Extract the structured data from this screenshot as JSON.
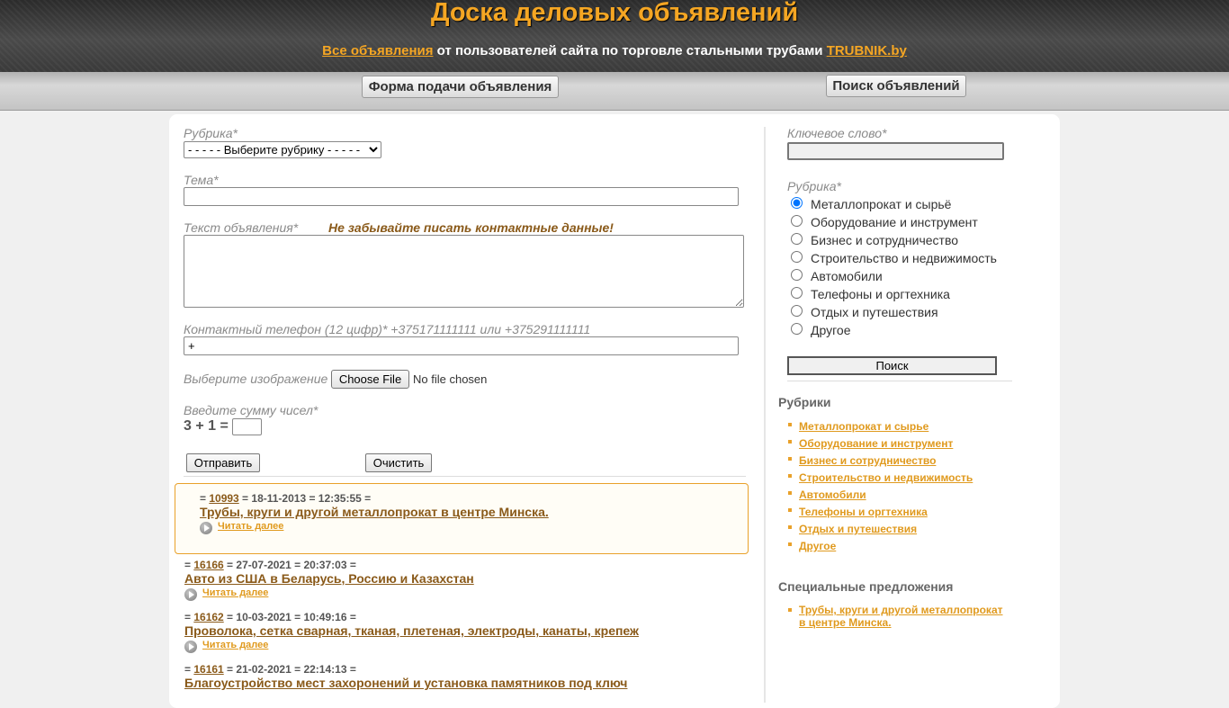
{
  "header": {
    "title": "Доска деловых объявлений",
    "subtitle_link1": "Все объявления",
    "subtitle_middle": " от пользователей сайта по торговле стальными трубами ",
    "subtitle_link2": "TRUBNIK.by"
  },
  "nav": {
    "form_button": "Форма подачи объявления",
    "search_button": "Поиск объявлений"
  },
  "form": {
    "rubric_label": "Рубрика*",
    "rubric_select": "- - - - - Выберите рубрику - - - - -",
    "subject_label": "Тема*",
    "subject_value": "",
    "text_label": "Текст объявления*",
    "text_warning": "Не забывайте писать контактные данные!",
    "text_value": "",
    "phone_label": "Контактный телефон (12 цифр)* +375171111111 или +375291111111",
    "phone_value": "+",
    "image_label": "Выберите изображение",
    "file_button": "Choose File",
    "file_status": "No file chosen",
    "captcha_label": "Введите сумму чисел*",
    "captcha_question": "3 + 1 =",
    "captcha_value": "",
    "submit_button": "Отправить",
    "reset_button": "Очистить"
  },
  "listings": [
    {
      "prefix": "= ",
      "id": "10993",
      "suffix": " = 18-11-2013 = 12:35:55 =",
      "title": "Трубы, круги и другой металлопрокат в центре Минска.",
      "readmore": "Читать далее"
    },
    {
      "prefix": "= ",
      "id": "16166",
      "suffix": " = 27-07-2021 = 20:37:03 =",
      "title": "Авто из США в Беларусь, Россию и Казахстан",
      "readmore": "Читать далее"
    },
    {
      "prefix": "= ",
      "id": "16162",
      "suffix": " = 10-03-2021 = 10:49:16 =",
      "title": "Проволока, сетка сварная, тканая, плетеная, электроды, канаты, крепеж",
      "readmore": "Читать далее"
    },
    {
      "prefix": "= ",
      "id": "16161",
      "suffix": " = 21-02-2021 = 22:14:13 =",
      "title": "Благоустройство мест захоронений и установка памятников под ключ"
    }
  ],
  "search": {
    "keyword_label": "Ключевое слово*",
    "keyword_value": "",
    "rubric_label": "Рубрика*",
    "options": [
      "Металлопрокат и сырьё",
      "Оборудование и инструмент",
      "Бизнес и сотрудничество",
      "Строительство и недвижимость",
      "Автомобили",
      "Телефоны и оргтехника",
      "Отдых и путешествия",
      "Другое"
    ],
    "selected_index": 0,
    "search_button": "Поиск"
  },
  "sidebar": {
    "rubrics_heading": "Рубрики",
    "rubrics": [
      "Металлопрокат и сырье",
      "Оборудование и инструмент",
      "Бизнес и сотрудничество",
      "Строительство и недвижимость",
      "Автомобили",
      "Телефоны и оргтехника",
      "Отдых и путешествия",
      "Другое"
    ],
    "special_heading": "Специальные предложения",
    "special": [
      "Трубы, круги и другой металлопрокат в центре Минска."
    ]
  },
  "colors": {
    "accent": "#f5a623",
    "link_dark": "#8a5a1a",
    "link_light": "#e09a1e",
    "featured_border": "#e9a12a"
  }
}
